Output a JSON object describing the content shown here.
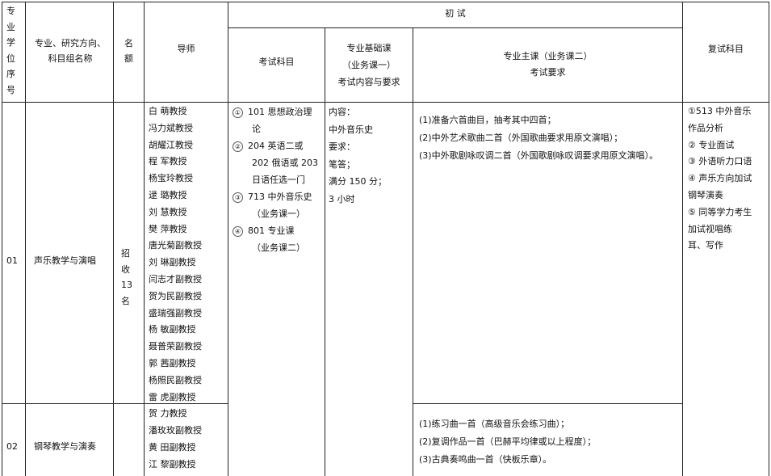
{
  "header": {
    "seq": [
      "专",
      "业",
      "学",
      "位",
      "序",
      "号"
    ],
    "major_l1": "专业、研究方向、",
    "major_l2": "科目组名称",
    "quota_l1": "名",
    "quota_l2": "额",
    "advisor": "导师",
    "initial": "初  试",
    "subjects": "考试科目",
    "basic_l1": "专业基础课",
    "basic_l2": "（业务课一）",
    "basic_l3": "考试内容与要求",
    "main_l1": "专业主课（业务课二）",
    "main_l2": "考试要求",
    "retest": "复试科目"
  },
  "rows": [
    {
      "code": "01",
      "name": "声乐教学与演唱"
    },
    {
      "code": "02",
      "name": "钢琴教学与演奏"
    }
  ],
  "quota_text": [
    "招",
    "收",
    "13",
    "名"
  ],
  "advisors": [
    "白  萌教授",
    "冯力斌教授",
    "胡耀江教授",
    "程  军教授",
    "杨宝玲教授",
    "逯  璐教授",
    "刘  慧教授",
    "樊  萍教授",
    "唐光菊副教授",
    "刘  琳副教授",
    "闫志才副教授",
    "贺为民副教授",
    "盛瑞强副教授",
    "杨  敏副教授",
    "聂普荣副教授",
    "郭  茜副教授",
    "杨照民副教授",
    "雷  虎副教授",
    "贺  力教授",
    "潘玫玫副教授",
    "黄  田副教授",
    "江  黎副教授"
  ],
  "subjects": [
    {
      "marker": "①",
      "lines": [
        "101 思想政治理",
        "论"
      ]
    },
    {
      "marker": "②",
      "lines": [
        "204 英语二或",
        "202 俄语或 203",
        "日语任选一门"
      ]
    },
    {
      "marker": "③",
      "lines": [
        "713 中外音乐史",
        "（业务课一）"
      ]
    },
    {
      "marker": "④",
      "lines": [
        "801 专业课",
        "（业务课二）"
      ]
    }
  ],
  "basic_content": [
    "内容：",
    "中外音乐史",
    "要求：",
    "笔答；",
    "满分 150 分；",
    "3 小时"
  ],
  "main_req_01": [
    "(1)准备六首曲目，抽考其中四首；",
    "(2)中外艺术歌曲二首（外国歌曲要求用原文演唱）；",
    "(3)中外歌剧咏叹调二首（外国歌剧咏叹调要求用原文演唱）。"
  ],
  "main_req_02": [
    "(1)练习曲一首（高级音乐会练习曲）；",
    "(2)复调作品一首（巴赫平均律或以上程度）；",
    "(3)古典奏鸣曲一首（快板乐章）。"
  ],
  "retest": [
    "①513 中外音乐",
    "  作品分析",
    "② 专业面试",
    "③ 外语听力口语",
    "④ 声乐方向加试",
    "  钢琴演奏",
    "⑤ 同等学力考生",
    "  加试视唱练",
    "  耳、写作"
  ]
}
